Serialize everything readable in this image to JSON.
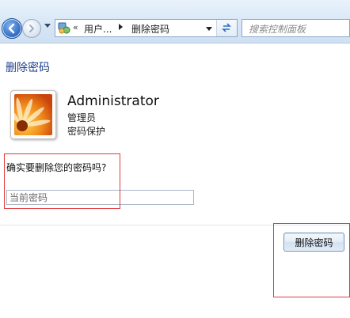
{
  "addressbar": {
    "chevron": "«",
    "crumb_parent": "用户...",
    "crumb_current": "删除密码",
    "control_panel_icon": "control-panel-icon",
    "refresh_icon": "refresh-icon"
  },
  "search": {
    "placeholder": "搜索控制面板"
  },
  "page": {
    "title": "删除密码"
  },
  "user": {
    "name": "Administrator",
    "role": "管理员",
    "status": "密码保护",
    "avatar_icon": "flower-avatar"
  },
  "form": {
    "question": "确实要删除您的密码吗?",
    "current_password_placeholder": "当前密码"
  },
  "actions": {
    "delete_label": "删除密码"
  },
  "colors": {
    "title_link": "#1e3f8e",
    "annotation_box": "#e03a3a",
    "toolbar_bg": "#d6e6f6"
  }
}
